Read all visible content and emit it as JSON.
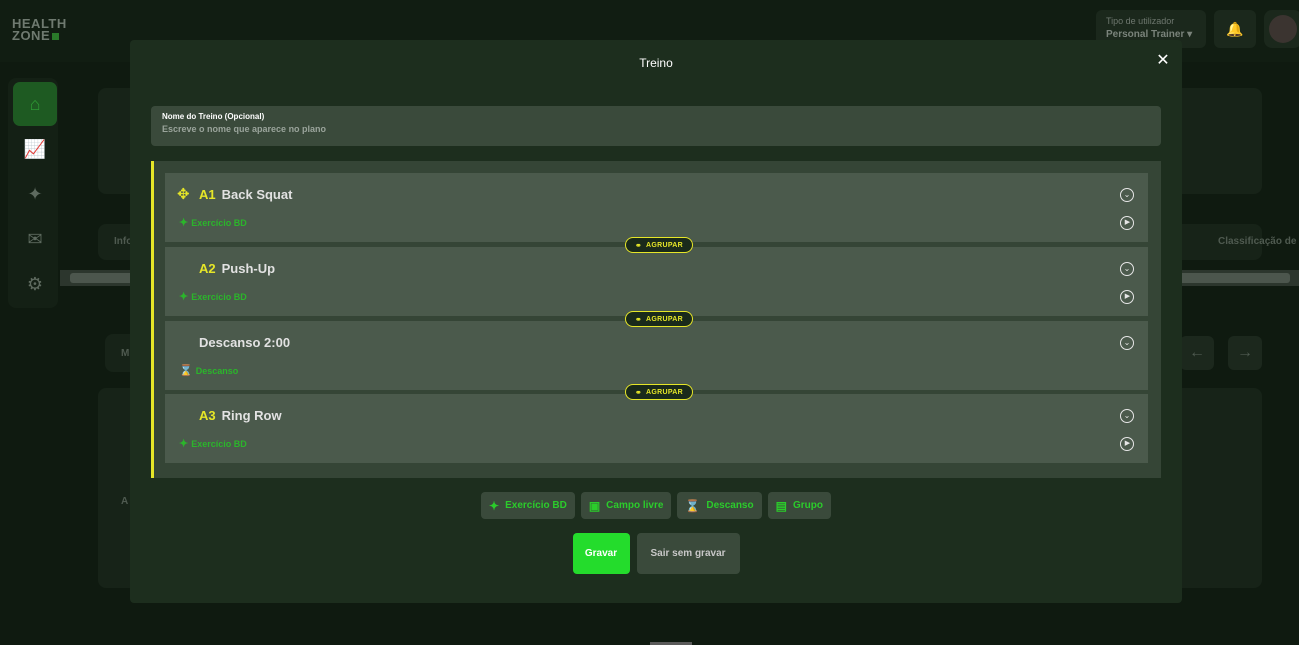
{
  "app": {
    "logo_line1": "HEALTH",
    "logo_line2": "ZONE",
    "user_type_label": "Tipo de utilizador",
    "user_type_value": "Personal Trainer ▾"
  },
  "background": {
    "tab_left": "Info",
    "tab_right": "Classificação de",
    "panel_label": "A",
    "panel_letter": "M"
  },
  "modal": {
    "title": "Treino",
    "close_icon": "close-icon",
    "name_field": {
      "label": "Nome do Treino (Opcional)",
      "placeholder": "Escreve o nome que aparece no plano",
      "value": ""
    },
    "accent_color": "#e6e628",
    "items": [
      {
        "code": "A1",
        "name": "Back Squat",
        "type": "Exercício BD",
        "type_icon": "dumbbell-icon",
        "has_drag": true,
        "has_play": true
      },
      {
        "code": "A2",
        "name": "Push-Up",
        "type": "Exercício BD",
        "type_icon": "dumbbell-icon",
        "has_drag": false,
        "has_play": true
      },
      {
        "code": "",
        "name": "Descanso 2:00",
        "type": "Descanso",
        "type_icon": "hourglass-icon",
        "has_drag": false,
        "has_play": false
      },
      {
        "code": "A3",
        "name": "Ring Row",
        "type": "Exercício BD",
        "type_icon": "dumbbell-icon",
        "has_drag": false,
        "has_play": true
      }
    ],
    "group_label": "AGRUPAR",
    "tools": [
      {
        "label": "Exercício BD",
        "icon": "dumbbell-icon"
      },
      {
        "label": "Campo livre",
        "icon": "text-field-icon"
      },
      {
        "label": "Descanso",
        "icon": "hourglass-icon"
      },
      {
        "label": "Grupo",
        "icon": "group-list-icon"
      }
    ],
    "save_label": "Gravar",
    "exit_label": "Sair sem gravar",
    "save_color": "#24dc2c"
  }
}
